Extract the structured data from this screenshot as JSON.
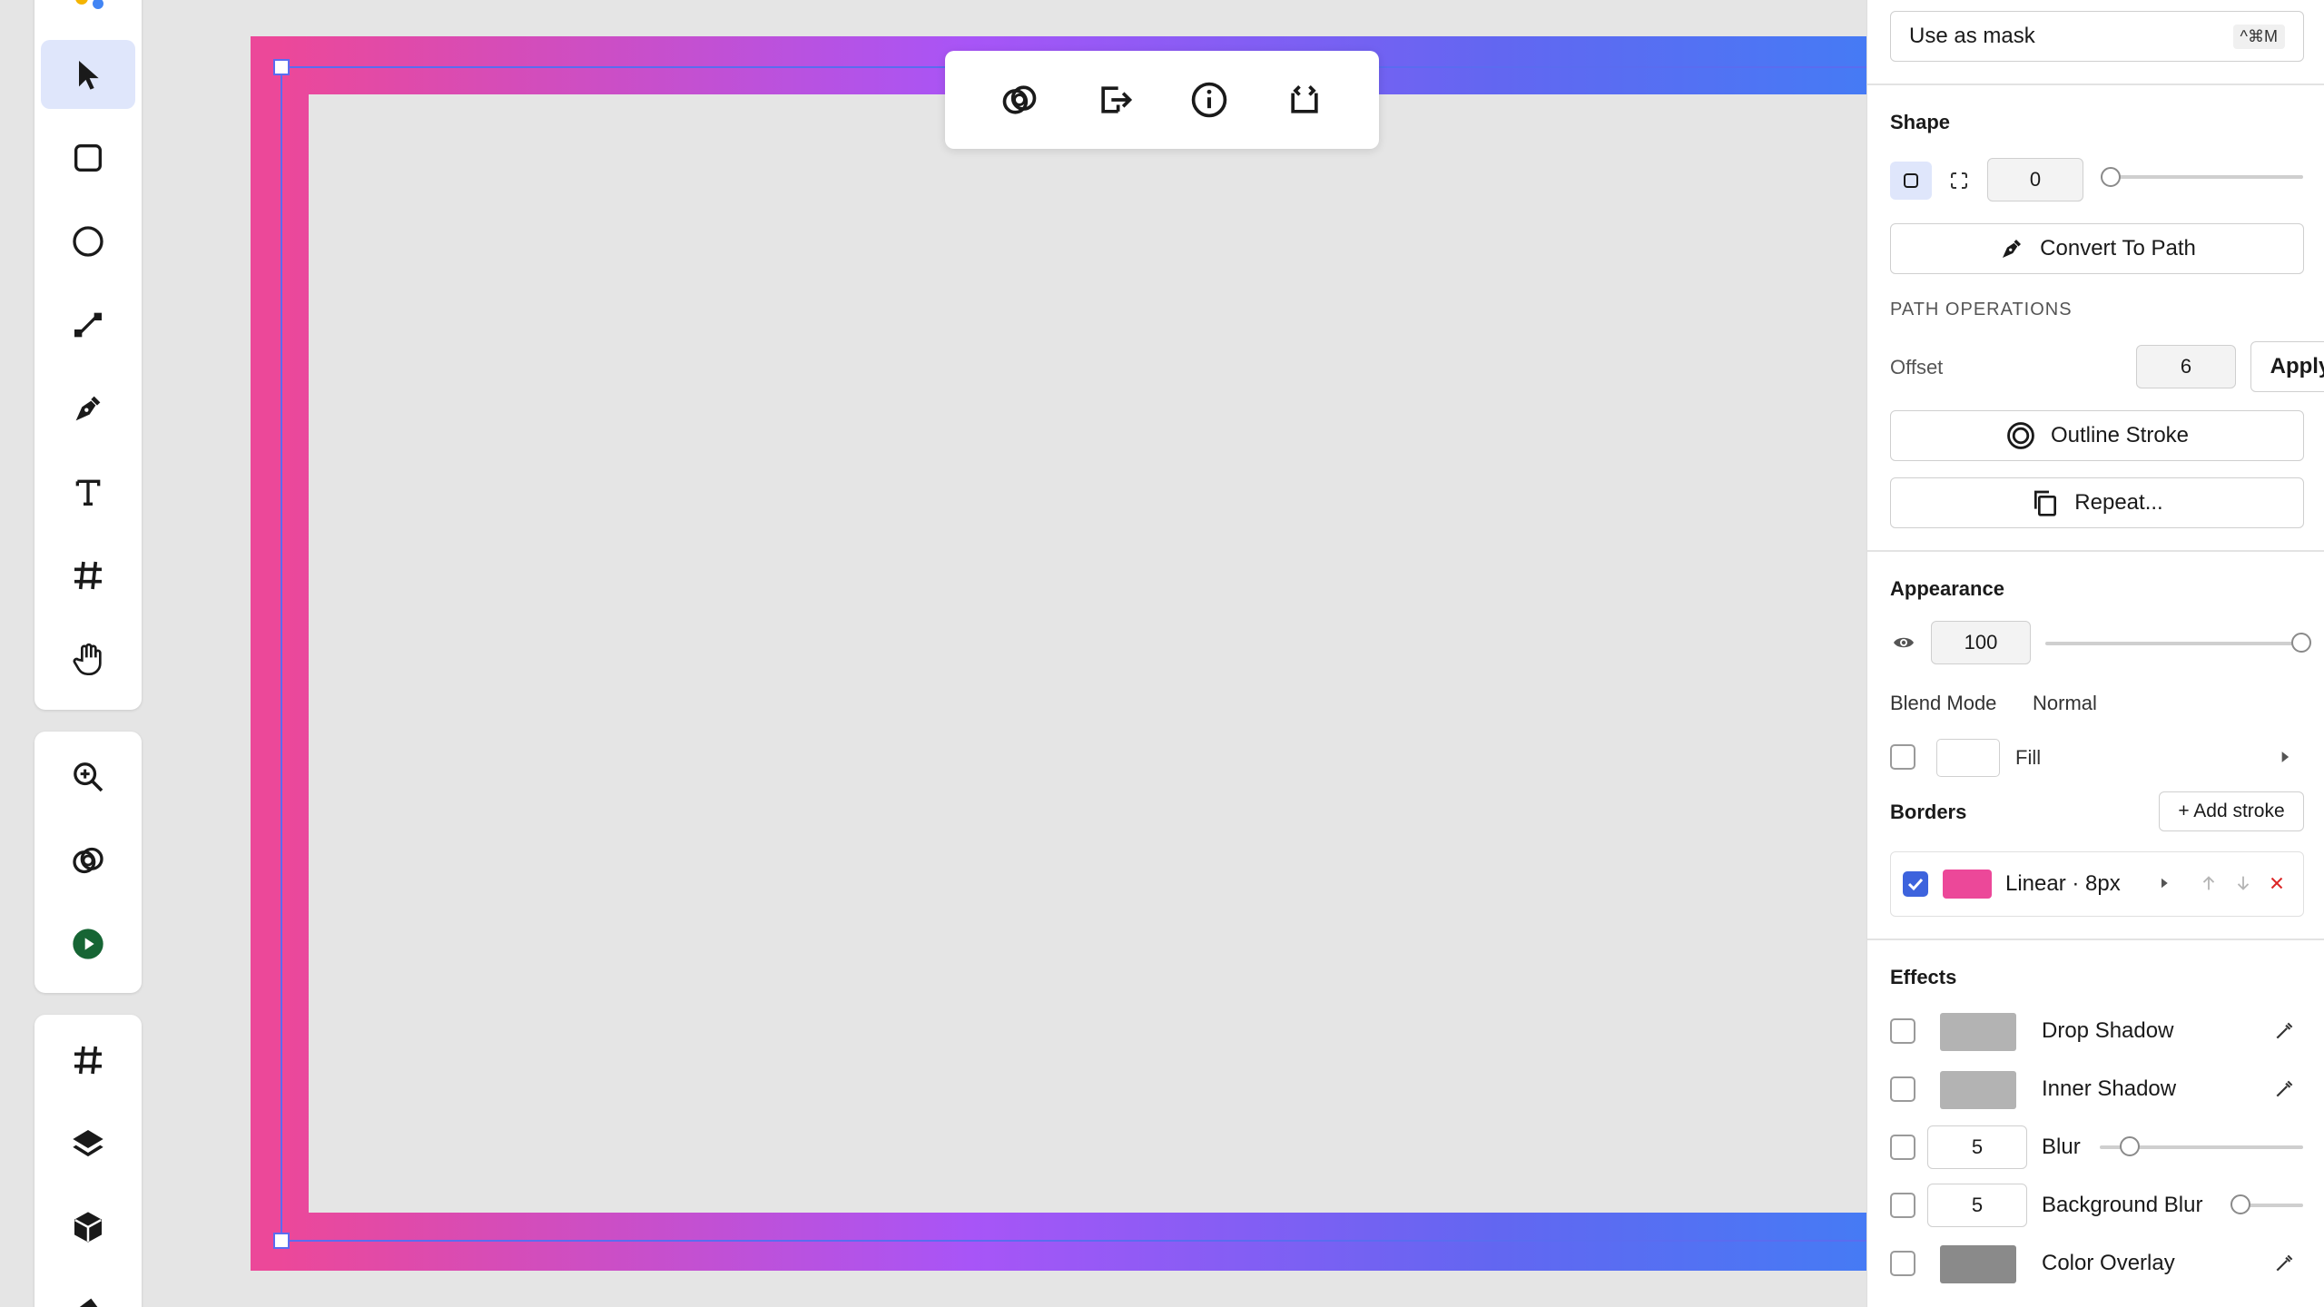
{
  "toolbar": {
    "tools": [
      {
        "name": "select-tool",
        "icon": "cursor-arrow-icon",
        "active": true
      },
      {
        "name": "rectangle-tool",
        "icon": "rounded-square-icon"
      },
      {
        "name": "ellipse-tool",
        "icon": "circle-icon"
      },
      {
        "name": "line-tool",
        "icon": "line-icon"
      },
      {
        "name": "pen-tool",
        "icon": "pen-nib-icon"
      },
      {
        "name": "text-tool",
        "icon": "text-t-icon"
      },
      {
        "name": "frame-tool",
        "icon": "hash-icon"
      },
      {
        "name": "hand-tool",
        "icon": "hand-icon"
      }
    ],
    "tools2": [
      {
        "name": "zoom-tool",
        "icon": "zoom-in-icon"
      },
      {
        "name": "boolean-tool",
        "icon": "overlap-circles-icon"
      },
      {
        "name": "play-tool",
        "icon": "play-circle-icon"
      }
    ],
    "tools3": [
      {
        "name": "grid-tool",
        "icon": "hash-icon"
      },
      {
        "name": "layers-tool",
        "icon": "layers-icon"
      },
      {
        "name": "3d-tool",
        "icon": "cube-icon"
      }
    ]
  },
  "canvas": {
    "frame_stroke_gradient": [
      "#ec4899",
      "#a855f7",
      "#6366f1",
      "#3b82f6"
    ],
    "background": "#e5e5e5"
  },
  "context_toolbar": {
    "buttons": [
      "boolean-icon",
      "export-icon",
      "info-icon",
      "code-embed-icon"
    ]
  },
  "panel": {
    "mask": {
      "label": "Use as mask",
      "shortcut": "^⌘M"
    },
    "shape": {
      "title": "Shape",
      "corner_radius": "0",
      "convert_label": "Convert To Path",
      "path_ops_title": "PATH OPERATIONS",
      "offset_label": "Offset",
      "offset_value": "6",
      "apply_label": "Apply",
      "outline_label": "Outline Stroke",
      "repeat_label": "Repeat..."
    },
    "appearance": {
      "title": "Appearance",
      "opacity": "100",
      "blend_label": "Blend Mode",
      "blend_value": "Normal",
      "fill_label": "Fill"
    },
    "borders": {
      "title": "Borders",
      "add_label": "+ Add stroke",
      "stroke_label": "Linear · 8px",
      "stroke_color": "#ec4899",
      "checked": true
    },
    "effects": {
      "title": "Effects",
      "items": [
        {
          "label": "Drop Shadow",
          "type": "swatch",
          "swatch_color": "#b3b3b3"
        },
        {
          "label": "Inner Shadow",
          "type": "swatch",
          "swatch_color": "#b3b3b3"
        },
        {
          "label": "Blur",
          "type": "number",
          "value": "5"
        },
        {
          "label": "Background Blur",
          "type": "number",
          "value": "5"
        },
        {
          "label": "Color Overlay",
          "type": "swatch",
          "swatch_color": "#8a8a8a"
        }
      ]
    }
  }
}
